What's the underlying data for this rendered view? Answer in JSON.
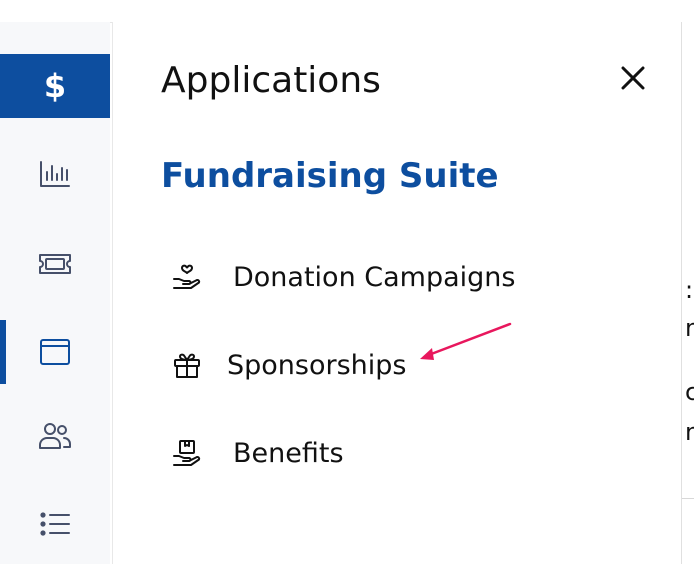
{
  "rail": {
    "dollar_symbol": "$",
    "items": [
      {
        "name": "analytics-icon"
      },
      {
        "name": "ticket-icon"
      },
      {
        "name": "applications-icon"
      },
      {
        "name": "users-icon"
      },
      {
        "name": "list-icon"
      }
    ]
  },
  "panel": {
    "title": "Applications",
    "section_title": "Fundraising Suite",
    "items": [
      {
        "label": "Donation Campaigns",
        "icon": "hand-heart-icon"
      },
      {
        "label": "Sponsorships",
        "icon": "gift-icon"
      },
      {
        "label": "Benefits",
        "icon": "hand-box-icon"
      }
    ]
  },
  "right_edge": {
    "fragments": [
      ":",
      "n",
      "c",
      "n"
    ]
  },
  "colors": {
    "brand": "#0d4e9f",
    "annotation_arrow": "#e8175d"
  }
}
